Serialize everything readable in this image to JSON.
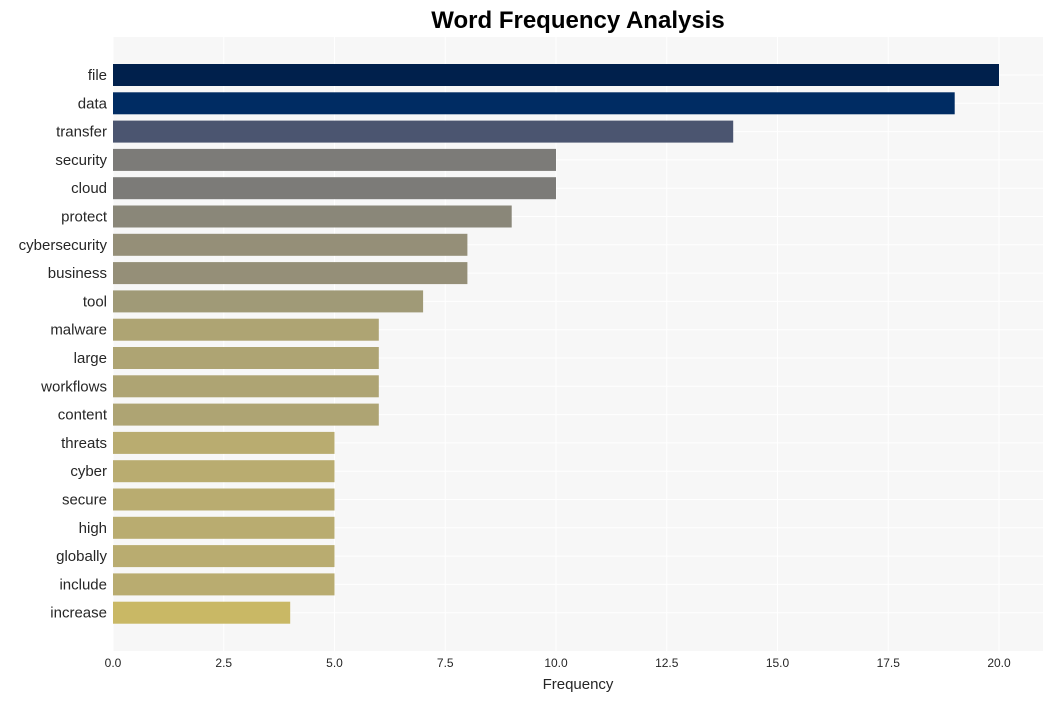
{
  "chart_data": {
    "type": "bar",
    "orientation": "horizontal",
    "title": "Word Frequency Analysis",
    "xlabel": "Frequency",
    "ylabel": "",
    "xlim": [
      0,
      21
    ],
    "xticks": [
      0.0,
      2.5,
      5.0,
      7.5,
      10.0,
      12.5,
      15.0,
      17.5,
      20.0
    ],
    "xtick_labels": [
      "0.0",
      "2.5",
      "5.0",
      "7.5",
      "10.0",
      "12.5",
      "15.0",
      "17.5",
      "20.0"
    ],
    "grid": true,
    "categories": [
      "file",
      "data",
      "transfer",
      "security",
      "cloud",
      "protect",
      "cybersecurity",
      "business",
      "tool",
      "malware",
      "large",
      "workflows",
      "content",
      "threats",
      "cyber",
      "secure",
      "high",
      "globally",
      "include",
      "increase"
    ],
    "values": [
      20,
      19,
      14,
      10,
      10,
      9,
      8,
      8,
      7,
      6,
      6,
      6,
      6,
      5,
      5,
      5,
      5,
      5,
      5,
      4
    ],
    "colors": [
      "#00204c",
      "#002c63",
      "#4b5570",
      "#7c7b78",
      "#7c7b78",
      "#8a8779",
      "#958f78",
      "#958f78",
      "#a09a77",
      "#aea473",
      "#aea473",
      "#aea473",
      "#aea473",
      "#b9ac70",
      "#b9ac70",
      "#b9ac70",
      "#b9ac70",
      "#b9ac70",
      "#b9ac70",
      "#c9b865"
    ]
  }
}
